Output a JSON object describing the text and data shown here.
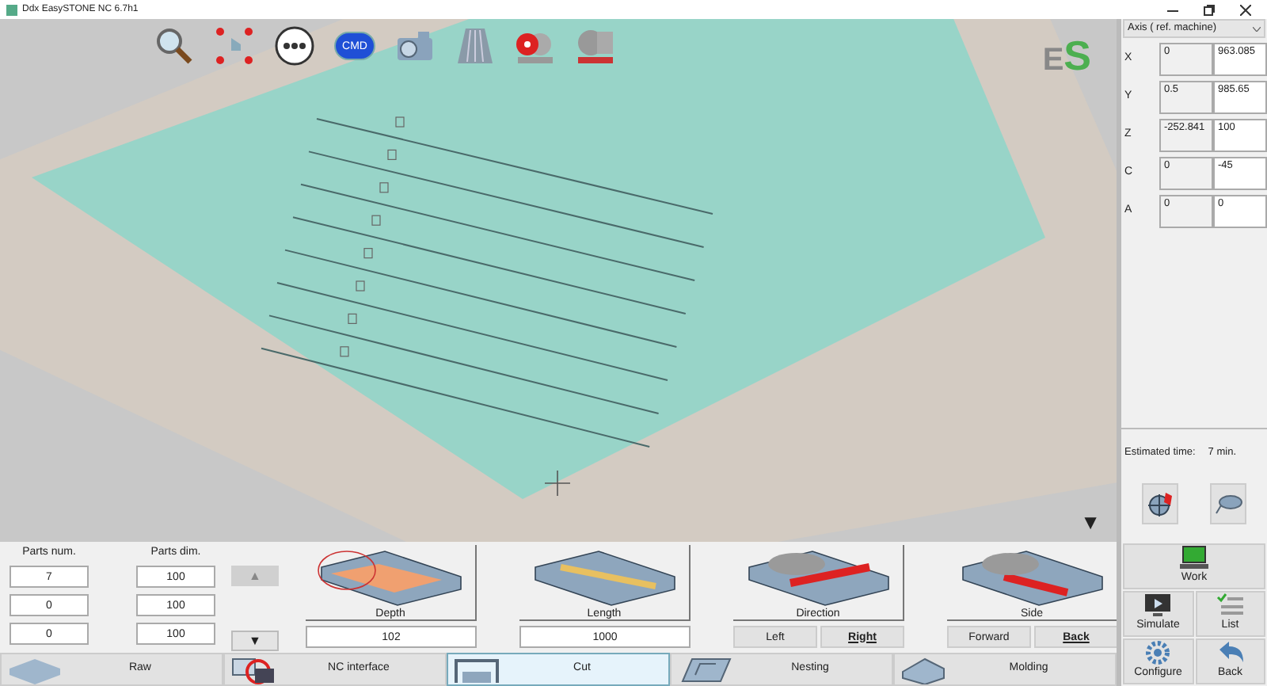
{
  "window": {
    "title": "Ddx EasySTONE NC 6.7h1"
  },
  "toolbar": {
    "cmd_label": "CMD"
  },
  "logo": {
    "first": "E",
    "second": "S"
  },
  "canvas": {
    "scroll_button": "▼"
  },
  "axis_panel": {
    "dropdown": "Axis ( ref. machine)",
    "rows": [
      {
        "axis": "X",
        "value_1": "0",
        "value_2": "963.085"
      },
      {
        "axis": "Y",
        "value_1": "0.5",
        "value_2": "985.65"
      },
      {
        "axis": "Z",
        "value_1": "-252.841",
        "value_2": "100"
      },
      {
        "axis": "C",
        "value_1": "0",
        "value_2": "-45"
      },
      {
        "axis": "A",
        "value_1": "0",
        "value_2": "0"
      }
    ]
  },
  "estimate": {
    "label": "Estimated time:",
    "value": "7 min."
  },
  "parts": {
    "columns": [
      "Parts num.",
      "Parts dim."
    ],
    "rows": [
      [
        "7",
        "100"
      ],
      [
        "0",
        "100"
      ],
      [
        "0",
        "100"
      ]
    ],
    "up": {
      "label": "▲",
      "disabled": true
    },
    "down": {
      "label": "▼",
      "disabled": false
    }
  },
  "operations": [
    {
      "kind": "value",
      "label": "Depth",
      "value": "102"
    },
    {
      "kind": "value",
      "label": "Length",
      "value": "1000"
    },
    {
      "kind": "choice",
      "label": "Direction",
      "options": [
        {
          "label": "Left",
          "selected": false
        },
        {
          "label": "Right",
          "selected": true
        }
      ]
    },
    {
      "kind": "choice",
      "label": "Side",
      "options": [
        {
          "label": "Forward",
          "selected": false
        },
        {
          "label": "Back",
          "selected": true
        }
      ]
    }
  ],
  "tabs": [
    {
      "label": "Raw",
      "selected": false
    },
    {
      "label": "NC interface",
      "selected": false
    },
    {
      "label": "Cut",
      "selected": true
    },
    {
      "label": "Nesting",
      "selected": false
    },
    {
      "label": "Molding",
      "selected": false
    }
  ],
  "actions": [
    {
      "label": "Work"
    },
    {
      "label": "Simulate"
    },
    {
      "label": "List"
    },
    {
      "label": "Configure"
    },
    {
      "label": "Back"
    }
  ]
}
